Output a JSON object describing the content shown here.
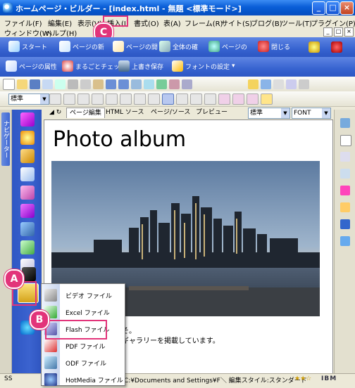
{
  "window": {
    "title": "ホームページ・ビルダー - [index.html - 無題 <標準モード>]",
    "minimize": "_",
    "maximize": "□",
    "close": "×"
  },
  "menu": {
    "row1": [
      "ファイル(F)",
      "編集(E)",
      "表示(V)",
      "挿入(I)",
      "書式(O)",
      "表(A)",
      "フレーム(R)",
      "サイト(S)",
      "ブログ(B)",
      "ツール(T)",
      "プラグイン(P)"
    ],
    "row2": [
      "ウィンドウ(W)",
      "ヘルプ(H)"
    ],
    "mdi": [
      "_",
      "□",
      "×"
    ]
  },
  "blue_toolbar1": [
    "スタート",
    "ページの新",
    "ページの開",
    "全体の確",
    "ページの",
    "閉じる"
  ],
  "blue_toolbar2": [
    "ページの属性",
    "まるごとチェック",
    "上書き保存",
    "フォントの設定"
  ],
  "format_bar": {
    "style_value": "標準"
  },
  "editor": {
    "tabs": [
      "ページ編集",
      "HTML ソース",
      "ページ/ソース",
      "プレビュー"
    ],
    "mode_select": "標準",
    "font_select": "FONT",
    "heading": "Photo album",
    "text1": "ようこそ。",
    "text2": "や写真ギャラリーを掲載しています。"
  },
  "navigator_tab": "ナビゲーター",
  "insert_menu": {
    "items": [
      {
        "label": "ビデオ ファイル",
        "icon": "video-file-icon"
      },
      {
        "label": "Excel ファイル",
        "icon": "excel-file-icon"
      },
      {
        "label": "Flash ファイル",
        "icon": "flash-file-icon"
      },
      {
        "label": "PDF ファイル",
        "icon": "pdf-file-icon"
      },
      {
        "label": "ODF ファイル",
        "icon": "odf-file-icon"
      },
      {
        "label": "HotMedia ファイル",
        "icon": "hotmedia-file-icon"
      }
    ]
  },
  "statusbar": {
    "mode": "SS",
    "path": "C:¥Documents and Settings¥F＼ 編集スタイル:スタンダード",
    "brand": "IBM"
  },
  "callouts": {
    "a": "A",
    "b": "B",
    "c": "C"
  },
  "colors": {
    "callout": "#e2347a",
    "title_blue": "#0a5ed7"
  }
}
